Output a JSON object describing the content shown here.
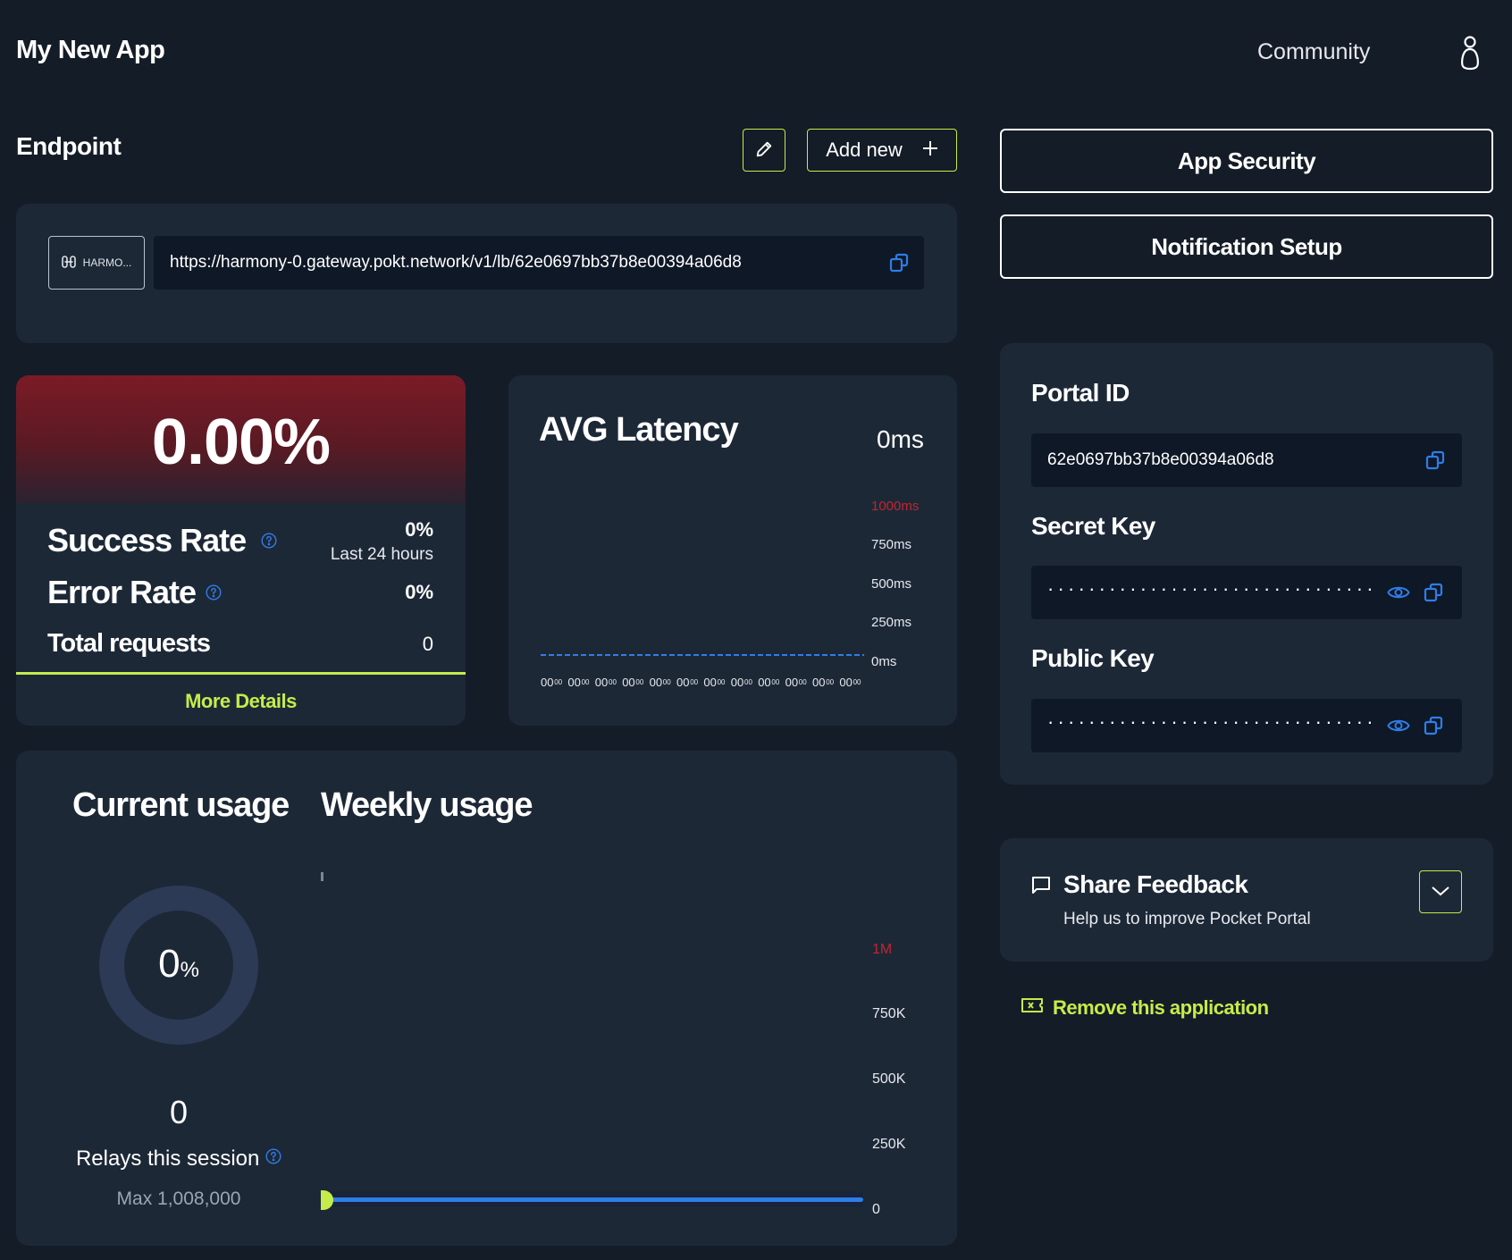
{
  "header": {
    "app_title": "My New App",
    "community_label": "Community"
  },
  "endpoint": {
    "title": "Endpoint",
    "add_new_label": "Add new",
    "chain_label": "HARMO...",
    "url": "https://harmony-0.gateway.pokt.network/v1/lb/62e0697bb37b8e00394a06d8"
  },
  "success": {
    "percent": "0.00%",
    "success_rate_label": "Success Rate",
    "success_rate_value": "0%",
    "period": "Last 24 hours",
    "error_rate_label": "Error Rate",
    "error_rate_value": "0%",
    "total_requests_label": "Total requests",
    "total_requests_value": "0",
    "more_details_label": "More Details"
  },
  "latency": {
    "title": "AVG Latency",
    "value": "0ms",
    "y_labels": [
      "1000ms",
      "750ms",
      "500ms",
      "250ms",
      "0ms"
    ],
    "x_tick": "00",
    "x_tick_small": "00"
  },
  "usage": {
    "current_title": "Current usage",
    "weekly_title": "Weekly usage",
    "donut_value": "0",
    "donut_unit": "%",
    "relays_count": "0",
    "relays_label": "Relays this session",
    "max_label": "Max 1,008,000",
    "weekly_y_labels": [
      "1M",
      "750K",
      "500K",
      "250K",
      "0"
    ],
    "progress_fraction": 0
  },
  "security": {
    "app_security_label": "App Security",
    "notification_setup_label": "Notification Setup"
  },
  "keys": {
    "portal_id_title": "Portal ID",
    "portal_id_value": "62e0697bb37b8e00394a06d8",
    "secret_key_title": "Secret Key",
    "secret_key_masked": "································",
    "public_key_title": "Public Key",
    "public_key_masked": "································"
  },
  "feedback": {
    "title": "Share Feedback",
    "subtitle": "Help us to improve Pocket Portal"
  },
  "remove": {
    "label": "Remove this application"
  },
  "colors": {
    "background": "#141c27",
    "card": "#1d2837",
    "field": "#0f1826",
    "accent_green": "#c5ec4b",
    "accent_blue": "#2f7de8",
    "alert_red": "#c0262e"
  },
  "icons": [
    "user-icon",
    "pencil-icon",
    "plus-icon",
    "chain-icon",
    "copy-icon",
    "question-icon",
    "eye-icon",
    "chat-icon",
    "chevron-down-icon",
    "ticket-icon"
  ]
}
